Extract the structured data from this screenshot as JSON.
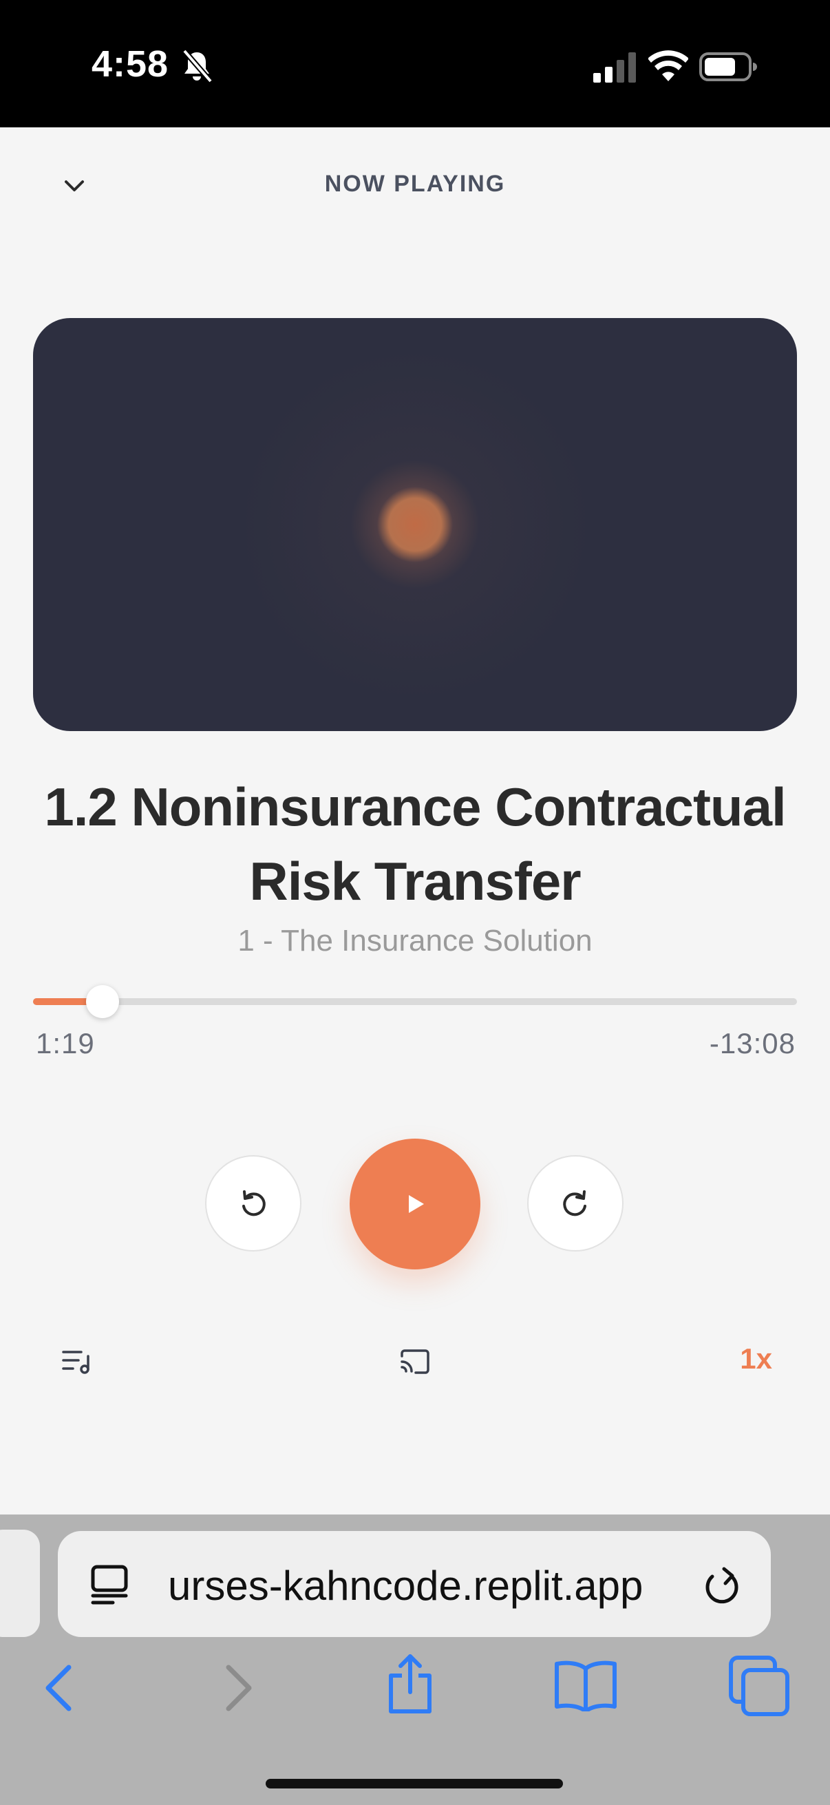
{
  "status_bar": {
    "time": "4:58"
  },
  "header": {
    "title": "NOW PLAYING"
  },
  "track": {
    "title": "1.2 Noninsurance Contractual Risk Transfer",
    "subtitle": "1 - The Insurance Solution"
  },
  "progress": {
    "elapsed": "1:19",
    "remaining": "-13:08",
    "fraction": 0.091
  },
  "controls": {
    "speed": "1x"
  },
  "browser": {
    "url": "urses-kahncode.replit.app"
  },
  "colors": {
    "accent": "#ee7e52",
    "artwork_bg": "#2d2f40",
    "browser_blue": "#2f7cf6"
  },
  "icons": {
    "header": "chevron-down-icon",
    "rewind": "rewind-icon",
    "play": "play-icon",
    "forward": "forward-icon",
    "playlist": "playlist-icon",
    "cast": "cast-icon"
  }
}
